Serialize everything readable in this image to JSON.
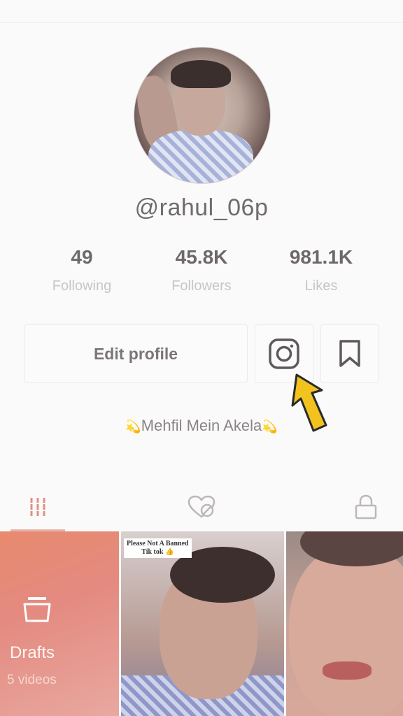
{
  "profile": {
    "username": "@rahul_06p",
    "bio_text": "Mehfil Mein Akela"
  },
  "stats": [
    {
      "value": "49",
      "label": "Following"
    },
    {
      "value": "45.8K",
      "label": "Followers"
    },
    {
      "value": "981.1K",
      "label": "Likes"
    }
  ],
  "actions": {
    "edit_label": "Edit profile"
  },
  "tabs": [
    {
      "icon": "grid-icon",
      "active": true
    },
    {
      "icon": "liked-hidden-icon",
      "active": false
    },
    {
      "icon": "lock-icon",
      "active": false
    }
  ],
  "videos": {
    "drafts_label": "Drafts",
    "drafts_count": "5 videos",
    "caption_line1": "Please Not A Banned",
    "caption_line2": "Tik tok 👍"
  },
  "colors": {
    "accent_underline": "#e6b3ad",
    "arrow": "#f2c21f"
  }
}
